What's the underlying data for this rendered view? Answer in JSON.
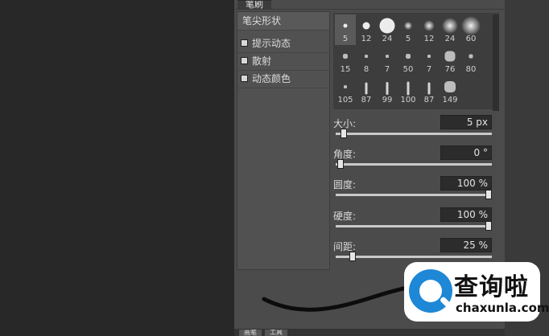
{
  "panel": {
    "tab_label": "笔刷"
  },
  "left_list": {
    "items": [
      {
        "label": "笔尖形状",
        "checkbox": false,
        "active": true
      },
      {
        "label": "提示动态",
        "checkbox": true,
        "checked": false
      },
      {
        "label": "散射",
        "checkbox": true,
        "checked": false
      },
      {
        "label": "动态颜色",
        "checkbox": true,
        "checked": false
      }
    ]
  },
  "brush_presets": [
    {
      "size": "5",
      "shape": "hard-round"
    },
    {
      "size": "12",
      "shape": "hard-round"
    },
    {
      "size": "24",
      "shape": "hard-round"
    },
    {
      "size": "5",
      "shape": "soft-round"
    },
    {
      "size": "12",
      "shape": "soft-round"
    },
    {
      "size": "24",
      "shape": "soft-round"
    },
    {
      "size": "60",
      "shape": "soft-round"
    },
    {
      "size": "15",
      "shape": "texture"
    },
    {
      "size": "8",
      "shape": "texture"
    },
    {
      "size": "7",
      "shape": "texture"
    },
    {
      "size": "50",
      "shape": "texture"
    },
    {
      "size": "7",
      "shape": "texture"
    },
    {
      "size": "76",
      "shape": "texture"
    },
    {
      "size": "80",
      "shape": "texture"
    },
    {
      "size": "105",
      "shape": "texture"
    },
    {
      "size": "87",
      "shape": "bristle"
    },
    {
      "size": "99",
      "shape": "bristle"
    },
    {
      "size": "100",
      "shape": "bristle"
    },
    {
      "size": "87",
      "shape": "bristle"
    },
    {
      "size": "149",
      "shape": "texture"
    }
  ],
  "parameters": [
    {
      "label": "大小:",
      "value": "5",
      "unit": "px",
      "level_percent": 3
    },
    {
      "label": "角度:",
      "value": "0",
      "unit": "°",
      "level_percent": 1
    },
    {
      "label": "圆度:",
      "value": "100",
      "unit": "%",
      "level_percent": 100
    },
    {
      "label": "硬度:",
      "value": "100",
      "unit": "%",
      "level_percent": 100
    },
    {
      "label": "间距:",
      "value": "25",
      "unit": "%",
      "level_percent": 9
    }
  ],
  "bottom_tabs": [
    "画笔",
    "工具"
  ],
  "watermark": {
    "title": "查询啦",
    "subtitle": "chaxunla.com"
  },
  "colors": {
    "panel_bg": "#4b4b4b",
    "canvas_bg": "#282828",
    "watermark_blue": "#1e88d6"
  }
}
